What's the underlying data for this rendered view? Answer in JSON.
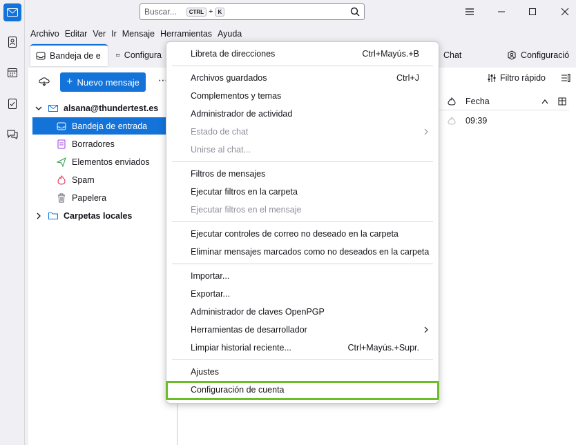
{
  "search": {
    "placeholder": "Buscar...",
    "key1": "CTRL",
    "plus": "+",
    "key2": "K"
  },
  "menubar": [
    "Archivo",
    "Editar",
    "Ver",
    "Ir",
    "Mensaje",
    "Herramientas",
    "Ayuda"
  ],
  "tabs": {
    "inbox": "Bandeja de e",
    "config": "Configura",
    "chat": "Chat",
    "account_config": "Configuració"
  },
  "folderpane": {
    "new_message": "Nuevo mensaje",
    "account": "alsana@thundertest.es",
    "folders": [
      "Bandeja de entrada",
      "Borradores",
      "Elementos enviados",
      "Spam",
      "Papelera"
    ],
    "local_folders": "Carpetas locales"
  },
  "messages": {
    "quick_filter": "Filtro rápido",
    "column_date": "Fecha",
    "row_time": "09:39"
  },
  "tools_menu": {
    "address_book": "Libreta de direcciones",
    "address_book_sc": "Ctrl+Mayús.+B",
    "saved_files": "Archivos guardados",
    "saved_files_sc": "Ctrl+J",
    "addons": "Complementos y temas",
    "activity": "Administrador de actividad",
    "chat_status": "Estado de chat",
    "join_chat": "Unirse al chat...",
    "filters": "Filtros de mensajes",
    "run_filters_folder": "Ejecutar filtros en la carpeta",
    "run_filters_message": "Ejecutar filtros en el mensaje",
    "run_junk": "Ejecutar controles de correo no deseado en la carpeta",
    "delete_junk": "Eliminar mensajes marcados como no deseados en la carpeta",
    "import": "Importar...",
    "export": "Exportar...",
    "openpgp": "Administrador de claves OpenPGP",
    "devtools": "Herramientas de desarrollador",
    "clear_history": "Limpiar historial reciente...",
    "clear_history_sc": "Ctrl+Mayús.+Supr.",
    "settings": "Ajustes",
    "account_settings": "Configuración de cuenta"
  },
  "colors": {
    "accent": "#1373d9",
    "highlight": "#6bbd2a"
  }
}
